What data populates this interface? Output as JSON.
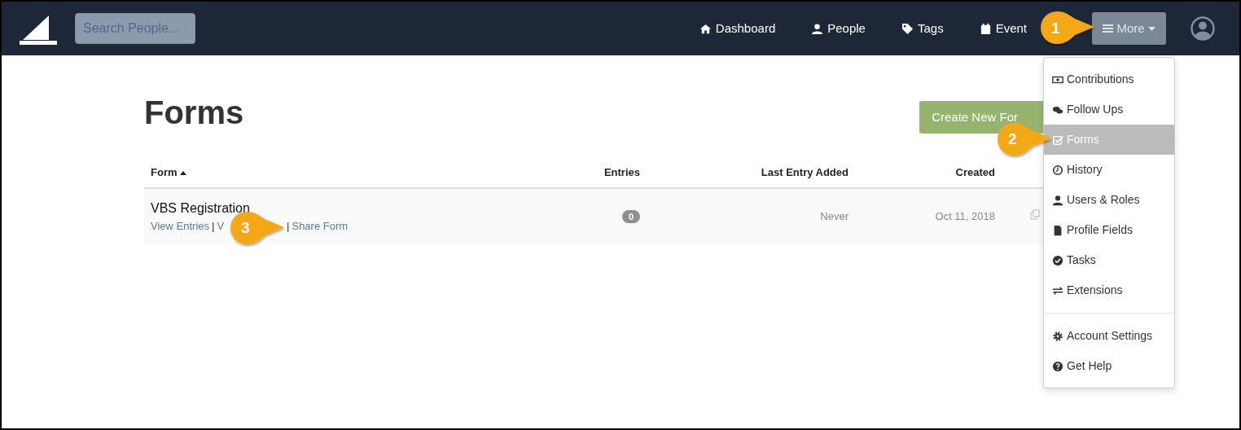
{
  "navbar": {
    "search": {
      "placeholder": "Search People..."
    },
    "nav_items": [
      {
        "label": "Dashboard"
      },
      {
        "label": "People"
      },
      {
        "label": "Tags"
      },
      {
        "label": "Event"
      }
    ],
    "more_button": {
      "label": "More",
      "expanded": true
    }
  },
  "menu": {
    "sections": [
      {
        "items": [
          {
            "label": "Contributions",
            "selected": false
          },
          {
            "label": "Follow Ups",
            "selected": false
          },
          {
            "label": "Forms",
            "selected": true
          },
          {
            "label": "History",
            "selected": false
          },
          {
            "label": "Users & Roles",
            "selected": false
          },
          {
            "label": "Profile Fields",
            "selected": false
          },
          {
            "label": "Tasks",
            "selected": false
          },
          {
            "label": "Extensions",
            "selected": false
          }
        ]
      },
      {
        "items": [
          {
            "label": "Account Settings",
            "selected": false
          },
          {
            "label": "Get Help",
            "selected": false
          }
        ]
      }
    ]
  },
  "page": {
    "title": "Forms",
    "create_button": "Create New For"
  },
  "table": {
    "columns": [
      {
        "label": "Form",
        "sorted": true
      },
      {
        "label": "Entries",
        "sorted": false
      },
      {
        "label": "Last Entry Added",
        "sorted": false
      },
      {
        "label": "Created",
        "sorted": false
      }
    ],
    "rows": [
      {
        "name": "VBS Registration",
        "links": [
          "View Entries",
          "V",
          "Share Form"
        ],
        "separators": [
          "|",
          "|"
        ],
        "entries": "0",
        "last_entry": "Never",
        "created": "Oct 11, 2018"
      }
    ]
  },
  "callouts": [
    {
      "number": "1"
    },
    {
      "number": "2"
    },
    {
      "number": "3"
    }
  ]
}
